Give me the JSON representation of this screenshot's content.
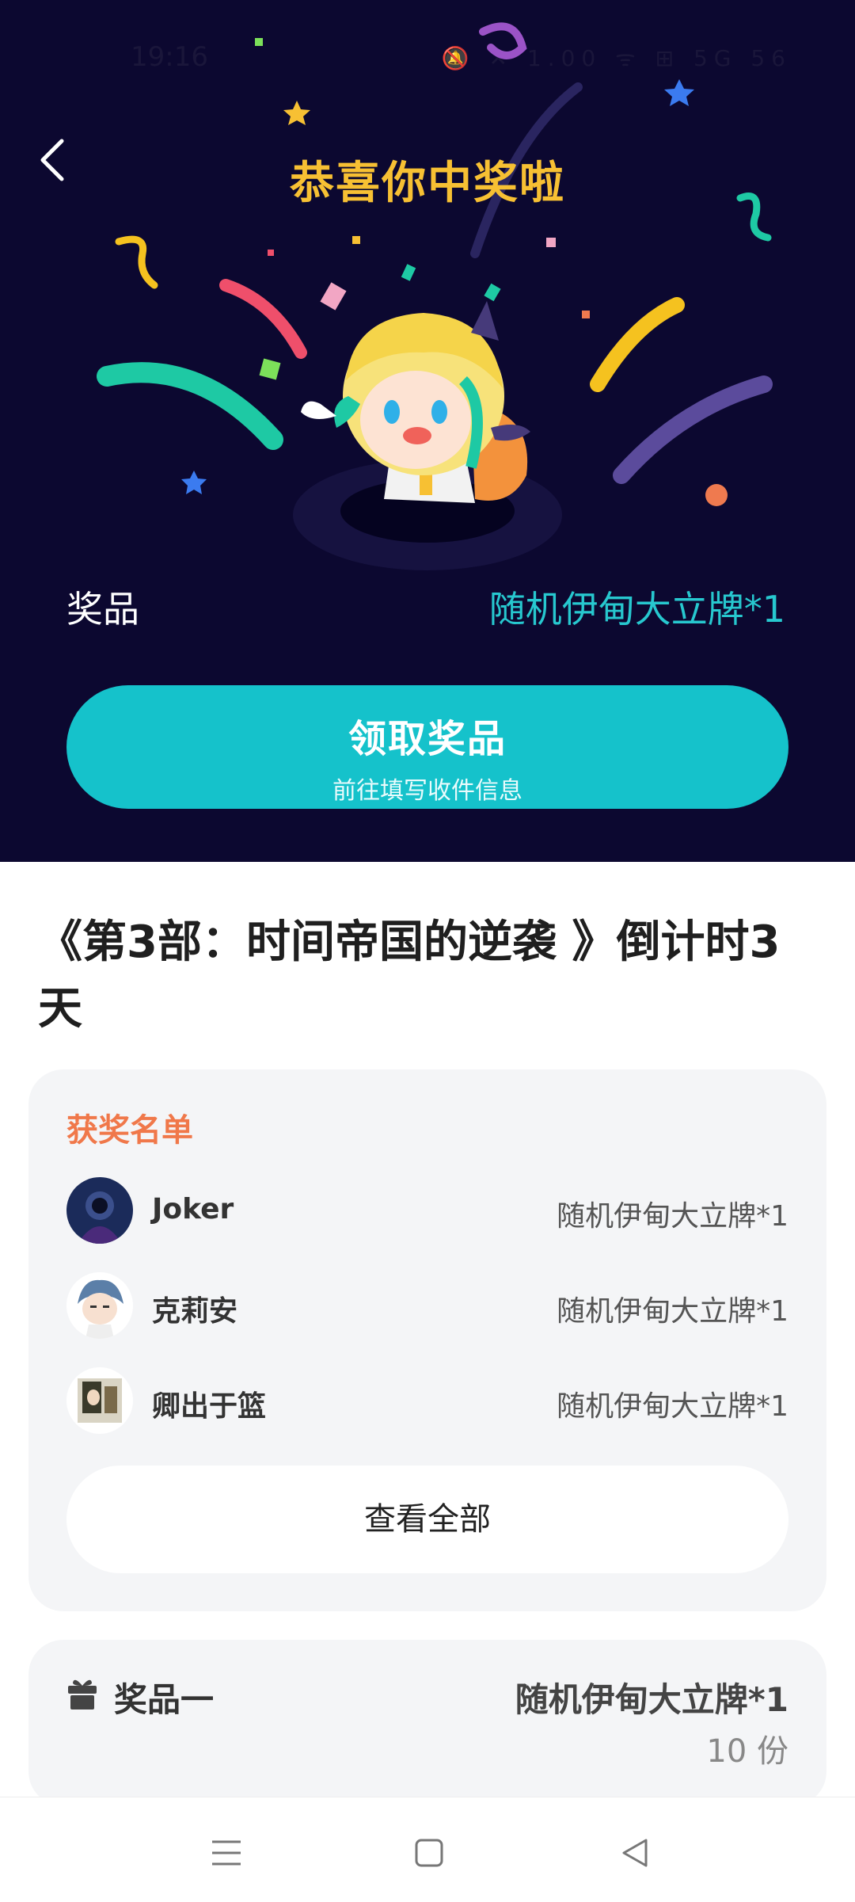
{
  "status_bar": {
    "time": "19:16",
    "icons_text": "🔕 ✕ 1.00 ᯤ ⊞ 5G 56"
  },
  "header": {
    "title": "恭喜你中奖啦"
  },
  "prize": {
    "label": "奖品",
    "value": "随机伊甸大立牌*1"
  },
  "claim_button": {
    "label": "领取奖品",
    "sublabel": "前往填写收件信息"
  },
  "event": {
    "title": "《第3部：时间帝国的逆袭 》倒计时3天"
  },
  "winners": {
    "heading": "获奖名单",
    "list": [
      {
        "name": "Joker",
        "prize": "随机伊甸大立牌*1"
      },
      {
        "name": "克莉安",
        "prize": "随机伊甸大立牌*1"
      },
      {
        "name": "卿出于篮",
        "prize": "随机伊甸大立牌*1"
      }
    ],
    "view_all": "查看全部"
  },
  "prize_item": {
    "label": "奖品一",
    "value": "随机伊甸大立牌*1",
    "quantity": "10 份"
  },
  "colors": {
    "banner_bg": "#0c0830",
    "title": "#f7c033",
    "accent": "#15c2cb",
    "winners_heading": "#f0784a"
  },
  "icons": [
    "back-icon",
    "gift-icon",
    "menu-icon",
    "home-icon",
    "back-nav-icon"
  ]
}
